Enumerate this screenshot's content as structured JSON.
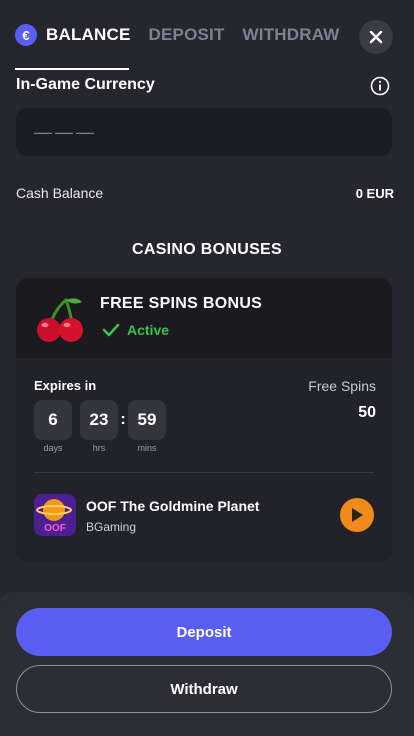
{
  "tabs": [
    {
      "label": "BALANCE",
      "active": true,
      "icon": "euro-badge-icon",
      "badge_symbol": "€"
    },
    {
      "label": "DEPOSIT",
      "active": false
    },
    {
      "label": "WITHDRAW",
      "active": false
    }
  ],
  "in_game_currency": {
    "title": "In-Game Currency",
    "value": "———"
  },
  "cash_balance": {
    "label": "Cash Balance",
    "value": "0 EUR"
  },
  "casino_bonuses": {
    "title": "CASINO BONUSES",
    "bonus": {
      "name": "FREE SPINS BONUS",
      "status": "Active",
      "icon": "cherry-icon",
      "expires_label": "Expires in",
      "timer": [
        {
          "value": "6",
          "unit": "days"
        },
        {
          "value": "23",
          "unit": "hrs"
        },
        {
          "value": "59",
          "unit": "mins"
        }
      ],
      "free_spins_label": "Free Spins",
      "free_spins_value": "50",
      "game": {
        "title": "OOF The Goldmine Planet",
        "provider": "BGaming",
        "thumb_text": "OOF"
      }
    }
  },
  "actions": {
    "deposit_label": "Deposit",
    "withdraw_label": "Withdraw"
  },
  "colors": {
    "accent": "#5b5ef2",
    "active_green": "#3cc14f",
    "play_orange": "#f08a1c",
    "background": "#26272e"
  }
}
